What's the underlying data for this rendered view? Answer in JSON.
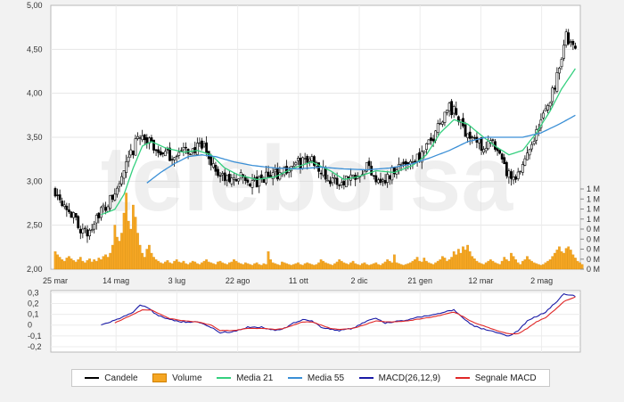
{
  "watermark": "teleborsa",
  "chart_data": [
    {
      "type": "candlestick",
      "panel": "price",
      "y_ticks": [
        "5,00",
        "4,50",
        "4,00",
        "3,50",
        "3,00",
        "2,50",
        "2,00"
      ],
      "ylim": [
        2.0,
        5.0
      ],
      "x_ticks": [
        "25 mar",
        "14 mag",
        "3 lug",
        "22 ago",
        "11 ott",
        "2 dic",
        "21 gen",
        "12 mar",
        "2 mag"
      ],
      "grid": true,
      "series": [
        {
          "name": "Candele",
          "color": "#000000",
          "anchors_close": [
            [
              0,
              2.9
            ],
            [
              5,
              2.72
            ],
            [
              10,
              2.5
            ],
            [
              14,
              2.38
            ],
            [
              18,
              2.62
            ],
            [
              22,
              2.7
            ],
            [
              26,
              2.85
            ],
            [
              30,
              3.1
            ],
            [
              34,
              3.35
            ],
            [
              37,
              3.55
            ],
            [
              40,
              3.45
            ],
            [
              45,
              3.35
            ],
            [
              50,
              3.28
            ],
            [
              55,
              3.33
            ],
            [
              60,
              3.36
            ],
            [
              65,
              3.38
            ],
            [
              68,
              3.22
            ],
            [
              72,
              3.05
            ],
            [
              76,
              3.0
            ],
            [
              80,
              3.05
            ],
            [
              84,
              3.0
            ],
            [
              88,
              2.97
            ],
            [
              92,
              3.05
            ],
            [
              96,
              3.08
            ],
            [
              100,
              3.12
            ],
            [
              104,
              3.18
            ],
            [
              108,
              3.22
            ],
            [
              112,
              3.25
            ],
            [
              116,
              3.15
            ],
            [
              120,
              3.0
            ],
            [
              124,
              2.98
            ],
            [
              128,
              3.05
            ],
            [
              132,
              3.1
            ],
            [
              136,
              3.18
            ],
            [
              140,
              3.05
            ],
            [
              144,
              3.0
            ],
            [
              148,
              3.15
            ],
            [
              152,
              3.2
            ],
            [
              156,
              3.25
            ],
            [
              160,
              3.3
            ],
            [
              164,
              3.45
            ],
            [
              168,
              3.7
            ],
            [
              172,
              3.85
            ],
            [
              175,
              3.75
            ],
            [
              178,
              3.6
            ],
            [
              182,
              3.5
            ],
            [
              186,
              3.4
            ],
            [
              190,
              3.45
            ],
            [
              193,
              3.3
            ],
            [
              196,
              3.15
            ],
            [
              200,
              2.98
            ],
            [
              203,
              3.1
            ],
            [
              206,
              3.35
            ],
            [
              210,
              3.55
            ],
            [
              214,
              3.8
            ],
            [
              218,
              4.1
            ],
            [
              221,
              4.45
            ],
            [
              223,
              4.65
            ],
            [
              225,
              4.55
            ],
            [
              227,
              4.48
            ]
          ]
        },
        {
          "name": "Media 21",
          "color": "#35d07f",
          "anchors": [
            [
              20,
              2.62
            ],
            [
              26,
              2.68
            ],
            [
              30,
              2.85
            ],
            [
              34,
              3.15
            ],
            [
              38,
              3.4
            ],
            [
              42,
              3.45
            ],
            [
              48,
              3.38
            ],
            [
              56,
              3.33
            ],
            [
              62,
              3.35
            ],
            [
              68,
              3.3
            ],
            [
              74,
              3.15
            ],
            [
              80,
              3.07
            ],
            [
              88,
              3.02
            ],
            [
              96,
              3.05
            ],
            [
              104,
              3.15
            ],
            [
              112,
              3.22
            ],
            [
              120,
              3.12
            ],
            [
              126,
              3.02
            ],
            [
              132,
              3.05
            ],
            [
              140,
              3.12
            ],
            [
              148,
              3.1
            ],
            [
              156,
              3.18
            ],
            [
              162,
              3.3
            ],
            [
              168,
              3.55
            ],
            [
              174,
              3.7
            ],
            [
              180,
              3.65
            ],
            [
              186,
              3.52
            ],
            [
              192,
              3.4
            ],
            [
              198,
              3.3
            ],
            [
              204,
              3.35
            ],
            [
              210,
              3.55
            ],
            [
              216,
              3.8
            ],
            [
              221,
              4.05
            ],
            [
              227,
              4.28
            ]
          ]
        },
        {
          "name": "Media 55",
          "color": "#3a8fd6",
          "anchors": [
            [
              40,
              2.98
            ],
            [
              46,
              3.1
            ],
            [
              52,
              3.2
            ],
            [
              58,
              3.28
            ],
            [
              64,
              3.3
            ],
            [
              70,
              3.28
            ],
            [
              78,
              3.22
            ],
            [
              86,
              3.18
            ],
            [
              96,
              3.15
            ],
            [
              106,
              3.14
            ],
            [
              116,
              3.16
            ],
            [
              126,
              3.14
            ],
            [
              136,
              3.13
            ],
            [
              146,
              3.15
            ],
            [
              156,
              3.2
            ],
            [
              164,
              3.27
            ],
            [
              172,
              3.35
            ],
            [
              180,
              3.45
            ],
            [
              188,
              3.5
            ],
            [
              196,
              3.5
            ],
            [
              204,
              3.5
            ],
            [
              212,
              3.55
            ],
            [
              220,
              3.65
            ],
            [
              227,
              3.75
            ]
          ]
        }
      ]
    },
    {
      "type": "bar",
      "panel": "volume",
      "name": "Volume",
      "color": "#f5a623",
      "y_ticks": [
        "1 M",
        "1 M",
        "1 M",
        "1 M",
        "0 M",
        "0 M",
        "0 M",
        "0 M",
        "0 M"
      ],
      "values": [
        0.22,
        0.18,
        0.15,
        0.12,
        0.1,
        0.14,
        0.16,
        0.13,
        0.11,
        0.09,
        0.12,
        0.15,
        0.1,
        0.08,
        0.11,
        0.13,
        0.09,
        0.12,
        0.1,
        0.14,
        0.12,
        0.16,
        0.18,
        0.15,
        0.2,
        0.3,
        0.55,
        0.4,
        0.35,
        0.45,
        0.7,
        0.95,
        0.6,
        0.5,
        0.8,
        0.65,
        0.45,
        0.3,
        0.2,
        0.15,
        0.25,
        0.3,
        0.2,
        0.15,
        0.12,
        0.1,
        0.08,
        0.07,
        0.09,
        0.11,
        0.08,
        0.07,
        0.1,
        0.12,
        0.09,
        0.08,
        0.1,
        0.07,
        0.06,
        0.08,
        0.1,
        0.09,
        0.07,
        0.06,
        0.08,
        0.1,
        0.12,
        0.09,
        0.08,
        0.07,
        0.06,
        0.09,
        0.1,
        0.08,
        0.07,
        0.06,
        0.08,
        0.09,
        0.12,
        0.1,
        0.08,
        0.07,
        0.06,
        0.08,
        0.07,
        0.06,
        0.05,
        0.07,
        0.08,
        0.06,
        0.05,
        0.07,
        0.06,
        0.22,
        0.12,
        0.08,
        0.07,
        0.06,
        0.05,
        0.09,
        0.08,
        0.07,
        0.06,
        0.05,
        0.06,
        0.07,
        0.08,
        0.06,
        0.05,
        0.07,
        0.08,
        0.07,
        0.06,
        0.05,
        0.06,
        0.08,
        0.12,
        0.1,
        0.08,
        0.07,
        0.06,
        0.05,
        0.07,
        0.09,
        0.12,
        0.1,
        0.08,
        0.07,
        0.06,
        0.08,
        0.1,
        0.07,
        0.06,
        0.05,
        0.07,
        0.08,
        0.06,
        0.05,
        0.06,
        0.07,
        0.08,
        0.06,
        0.05,
        0.07,
        0.09,
        0.12,
        0.1,
        0.08,
        0.18,
        0.08,
        0.07,
        0.06,
        0.05,
        0.06,
        0.07,
        0.08,
        0.1,
        0.12,
        0.15,
        0.1,
        0.09,
        0.14,
        0.1,
        0.08,
        0.07,
        0.06,
        0.08,
        0.1,
        0.12,
        0.16,
        0.14,
        0.1,
        0.12,
        0.15,
        0.22,
        0.18,
        0.25,
        0.2,
        0.28,
        0.24,
        0.3,
        0.22,
        0.16,
        0.13,
        0.1,
        0.08,
        0.07,
        0.06,
        0.08,
        0.1,
        0.12,
        0.1,
        0.08,
        0.07,
        0.06,
        0.1,
        0.15,
        0.12,
        0.1,
        0.2,
        0.16,
        0.12,
        0.08,
        0.06,
        0.1,
        0.12,
        0.16,
        0.12,
        0.1,
        0.08,
        0.07,
        0.06,
        0.05,
        0.06,
        0.08,
        0.1,
        0.12,
        0.16,
        0.2,
        0.24,
        0.28,
        0.22,
        0.2,
        0.26,
        0.28,
        0.24,
        0.18,
        0.14,
        0.1,
        0.08,
        0.06
      ]
    },
    {
      "type": "line",
      "panel": "macd",
      "y_ticks": [
        "0,3",
        "0,2",
        "0,1",
        "0",
        "-0,1",
        "-0,2"
      ],
      "ylim": [
        -0.25,
        0.32
      ],
      "series": [
        {
          "name": "MACD(26,12,9)",
          "color": "#1a1aa6",
          "anchors": [
            [
              20,
              0.0
            ],
            [
              25,
              0.04
            ],
            [
              30,
              0.08
            ],
            [
              34,
              0.12
            ],
            [
              37,
              0.18
            ],
            [
              40,
              0.17
            ],
            [
              44,
              0.1
            ],
            [
              48,
              0.06
            ],
            [
              52,
              0.04
            ],
            [
              56,
              0.03
            ],
            [
              62,
              0.03
            ],
            [
              68,
              -0.02
            ],
            [
              72,
              -0.07
            ],
            [
              78,
              -0.06
            ],
            [
              84,
              -0.02
            ],
            [
              90,
              -0.02
            ],
            [
              96,
              -0.05
            ],
            [
              100,
              -0.03
            ],
            [
              104,
              0.02
            ],
            [
              108,
              0.05
            ],
            [
              112,
              0.04
            ],
            [
              116,
              -0.02
            ],
            [
              120,
              -0.04
            ],
            [
              124,
              -0.05
            ],
            [
              130,
              -0.03
            ],
            [
              136,
              0.04
            ],
            [
              140,
              0.06
            ],
            [
              144,
              0.02
            ],
            [
              148,
              0.03
            ],
            [
              154,
              0.05
            ],
            [
              160,
              0.08
            ],
            [
              166,
              0.1
            ],
            [
              170,
              0.12
            ],
            [
              174,
              0.14
            ],
            [
              178,
              0.07
            ],
            [
              182,
              0.0
            ],
            [
              186,
              -0.03
            ],
            [
              190,
              -0.05
            ],
            [
              194,
              -0.08
            ],
            [
              198,
              -0.1
            ],
            [
              202,
              -0.05
            ],
            [
              206,
              0.04
            ],
            [
              210,
              0.08
            ],
            [
              214,
              0.12
            ],
            [
              218,
              0.2
            ],
            [
              222,
              0.29
            ],
            [
              227,
              0.27
            ]
          ]
        },
        {
          "name": "Segnale MACD",
          "color": "#e02828",
          "anchors": [
            [
              26,
              0.02
            ],
            [
              30,
              0.06
            ],
            [
              34,
              0.1
            ],
            [
              38,
              0.14
            ],
            [
              42,
              0.14
            ],
            [
              46,
              0.1
            ],
            [
              50,
              0.06
            ],
            [
              56,
              0.04
            ],
            [
              62,
              0.03
            ],
            [
              68,
              0.0
            ],
            [
              72,
              -0.05
            ],
            [
              78,
              -0.05
            ],
            [
              84,
              -0.03
            ],
            [
              90,
              -0.03
            ],
            [
              96,
              -0.04
            ],
            [
              100,
              -0.03
            ],
            [
              104,
              0.0
            ],
            [
              108,
              0.03
            ],
            [
              112,
              0.03
            ],
            [
              116,
              0.0
            ],
            [
              120,
              -0.03
            ],
            [
              124,
              -0.04
            ],
            [
              130,
              -0.03
            ],
            [
              136,
              0.01
            ],
            [
              140,
              0.04
            ],
            [
              144,
              0.03
            ],
            [
              148,
              0.03
            ],
            [
              154,
              0.04
            ],
            [
              160,
              0.06
            ],
            [
              166,
              0.08
            ],
            [
              170,
              0.1
            ],
            [
              174,
              0.12
            ],
            [
              178,
              0.08
            ],
            [
              182,
              0.03
            ],
            [
              186,
              0.0
            ],
            [
              190,
              -0.03
            ],
            [
              194,
              -0.06
            ],
            [
              198,
              -0.08
            ],
            [
              202,
              -0.08
            ],
            [
              206,
              -0.03
            ],
            [
              210,
              0.03
            ],
            [
              214,
              0.07
            ],
            [
              218,
              0.14
            ],
            [
              222,
              0.22
            ],
            [
              227,
              0.26
            ]
          ]
        }
      ]
    }
  ],
  "legend": {
    "candles": {
      "label": "Candele",
      "color": "#000000"
    },
    "volume": {
      "label": "Volume",
      "color": "#f5a623"
    },
    "ma21": {
      "label": "Media 21",
      "color": "#35d07f"
    },
    "ma55": {
      "label": "Media 55",
      "color": "#3a8fd6"
    },
    "macd": {
      "label": "MACD(26,12,9)",
      "color": "#1a1aa6"
    },
    "signal": {
      "label": "Segnale MACD",
      "color": "#e02828"
    }
  }
}
